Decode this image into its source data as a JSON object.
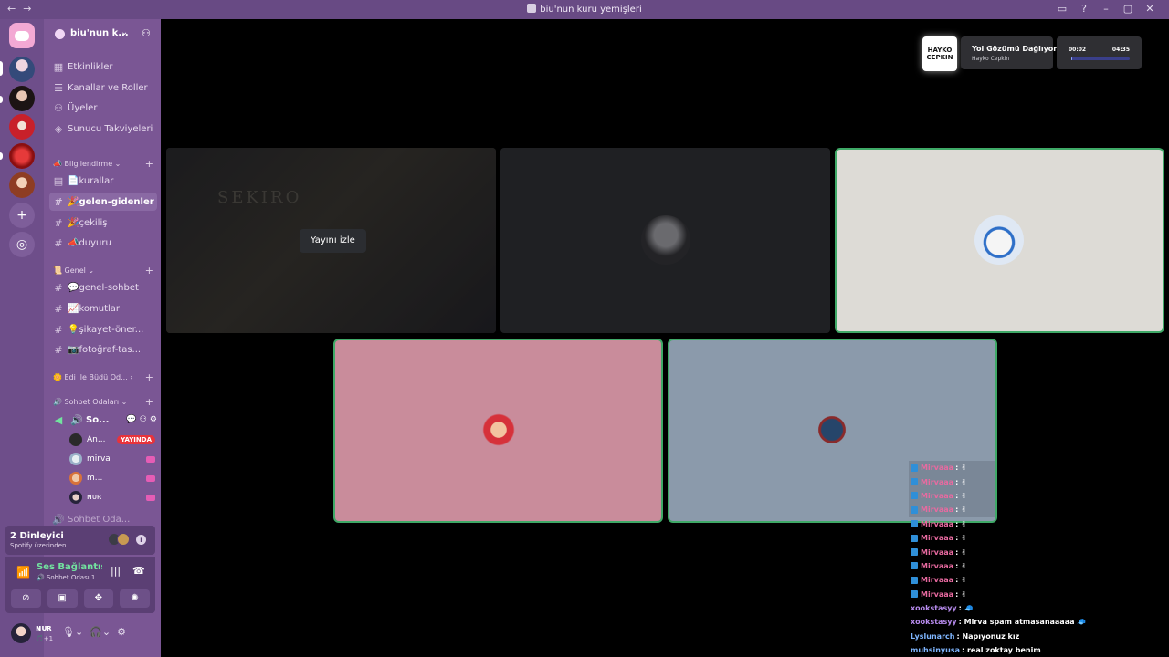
{
  "window": {
    "title": "biu'nun kuru yemişleri",
    "nav_back": "←",
    "nav_forward": "→",
    "controls": [
      "▭",
      "?",
      "–",
      "▢",
      "✕"
    ]
  },
  "server": {
    "name": "biu'nun k...",
    "menu": [
      {
        "icon": "calendar-icon",
        "label": "Etkinlikler"
      },
      {
        "icon": "channels-icon",
        "label": "Kanallar ve Roller"
      },
      {
        "icon": "members-icon",
        "label": "Üyeler"
      },
      {
        "icon": "boost-icon",
        "label": "Sunucu Takviyeleri"
      }
    ],
    "categories": [
      {
        "name": "📣 Bilgilendirme ⌄",
        "channels": [
          {
            "glyph": "▤",
            "label": "📄kurallar"
          },
          {
            "glyph": "#",
            "label": "🎉gelen-gidenler",
            "active": true
          },
          {
            "glyph": "#",
            "label": "🎉çekiliş"
          },
          {
            "glyph": "#",
            "label": "📣duyuru"
          }
        ]
      },
      {
        "name": "📜 Genel ⌄",
        "channels": [
          {
            "glyph": "#",
            "label": "💬genel-sohbet"
          },
          {
            "glyph": "#",
            "label": "📈komutlar"
          },
          {
            "glyph": "#",
            "label": "💡şikayet-öner..."
          },
          {
            "glyph": "#",
            "label": "📷fotoğraf-tas..."
          }
        ]
      }
    ],
    "collapsed_category": "🌼 Edi İle Büdü Od... ›",
    "voice_category": "🔊 Sohbet Odaları ⌄",
    "voice_channel": "So...",
    "voice_members": [
      {
        "name": "An...",
        "badge": "YAYINDA"
      },
      {
        "name": "mirva"
      },
      {
        "name": "m..."
      },
      {
        "name": "ɴᴜʀ"
      }
    ],
    "next_voice_channel": "Sohbet Oda..."
  },
  "listeners": {
    "title": "2 Dinleyici",
    "subtitle": "Spotify üzerinden",
    "info": "i"
  },
  "voice": {
    "status": "Ses Bağlantısı K",
    "channel": "Sohbet Odası 1..."
  },
  "user": {
    "name": "ɴᴜʀ",
    "status": "🎵+1"
  },
  "stream": {
    "watch_label": "Yayını izle",
    "game_title": "SEKIRO"
  },
  "now_playing": {
    "cover_text": "HAYKO CEPKIN",
    "title": "Yol Gözümü Dağlıyor",
    "artist": "Hayko Cepkin",
    "elapsed": "00:02",
    "duration": "04:35",
    "progress": 0.008
  },
  "chat": [
    {
      "badge": true,
      "name": "Mirvaaa",
      "msg": ": ✌",
      "hl": true
    },
    {
      "badge": true,
      "name": "Mirvaaa",
      "msg": ": ✌",
      "hl": true
    },
    {
      "badge": true,
      "name": "Mirvaaa",
      "msg": ": ✌",
      "hl": true
    },
    {
      "badge": true,
      "name": "Mirvaaa",
      "msg": ": ✌",
      "hl": true
    },
    {
      "badge": true,
      "name": "Mirvaaa",
      "msg": ": ✌"
    },
    {
      "badge": true,
      "name": "Mirvaaa",
      "msg": ": ✌"
    },
    {
      "badge": true,
      "name": "Mirvaaa",
      "msg": ": ✌"
    },
    {
      "badge": true,
      "name": "Mirvaaa",
      "msg": ": ✌"
    },
    {
      "badge": true,
      "name": "Mirvaaa",
      "msg": ": ✌"
    },
    {
      "badge": true,
      "name": "Mirvaaa",
      "msg": ": ✌"
    },
    {
      "badge": false,
      "name": "xookstasyy",
      "msg": ": 🧢"
    },
    {
      "badge": false,
      "name": "xookstasyy",
      "msg": ": Mirva spam atmasanaaaaa 🧢"
    },
    {
      "badge": false,
      "name": "Lyslunarch",
      "msg": ": Napıyonuz kız"
    },
    {
      "badge": false,
      "name": "muhsinyusa",
      "msg": ": real zoktay benim"
    }
  ],
  "colors": {
    "sidebar": "#7a5694",
    "guilds": "#6e4e8a",
    "speaking": "#3fa967",
    "chat_badge_name": "#e86aa0",
    "chat_name_purple": "#b98cf0",
    "chat_name_blue": "#7fb6ff"
  }
}
